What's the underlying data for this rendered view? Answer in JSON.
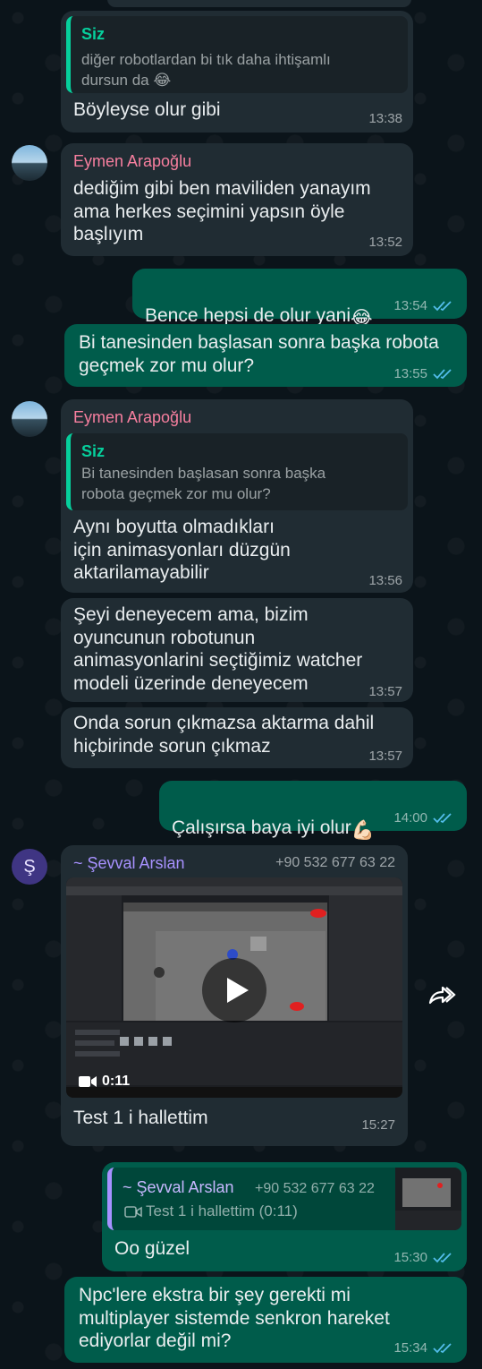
{
  "messages": {
    "m1": {
      "quote_name": "Siz",
      "quote_text": "diğer robotlardan bi tık daha ihtişamlı\ndursun da 😂",
      "text": "Böyleyse olur gibi",
      "time": "13:38"
    },
    "m2": {
      "sender": "Eymen Arapoğlu",
      "text": "dediğim gibi ben maviliden yanayım\nama herkes seçimini yapsın öyle\nbaşlıyım",
      "time": "13:52"
    },
    "m3": {
      "text": "Bence hepsi de olur yani",
      "emoji": "😂",
      "time": "13:54"
    },
    "m4": {
      "text": "Bi tanesinden başlasan sonra başka robota\ngeçmek zor mu olur?",
      "time": "13:55"
    },
    "m5": {
      "sender": "Eymen Arapoğlu",
      "quote_name": "Siz",
      "quote_text": "Bi tanesinden başlasan sonra başka\nrobota geçmek zor mu olur?",
      "text": "Aynı boyutta olmadıkları\niçin animasyonları düzgün\naktarilamayabilir",
      "time": "13:56"
    },
    "m6": {
      "text": "Şeyi deneyecem ama, bizim\noyuncunun robotunun\nanimasyonlarini seçtiğimiz watcher\nmodeli üzerinde deneyecem",
      "time": "13:57"
    },
    "m7": {
      "text": "Onda sorun çıkmazsa aktarma dahil\nhiçbirinde sorun çıkmaz",
      "time": "13:57"
    },
    "m8": {
      "text": "Çalışırsa baya iyi olur",
      "emoji": "💪🏻",
      "time": "14:00"
    },
    "m9": {
      "avatar_letter": "Ş",
      "sender": "~ Şevval Arslan",
      "phone": "+90 532 677 63 22",
      "video_duration": "0:11",
      "text": "Test 1 i hallettim",
      "time": "15:27"
    },
    "m10": {
      "quote_name": "~ Şevval Arslan",
      "quote_phone": "+90 532 677 63 22",
      "quote_text": "Test 1 i hallettim (0:11)",
      "text": "Oo güzel",
      "time": "15:30"
    },
    "m11": {
      "text": "Npc'lere ekstra bir şey gerekti mi\nmultiplayer sistemde senkron hareket\nediyorlar değil mi?",
      "time": "15:34"
    }
  },
  "icons": {
    "read_receipt": "double-check-icon",
    "forward": "forward-icon",
    "play": "play-icon",
    "video_camera": "video-camera-icon"
  },
  "colors": {
    "background": "#0b141a",
    "incoming_bubble": "#202c33",
    "outgoing_bubble": "#005c4b",
    "read_tick": "#53bdeb",
    "quote_accent": "#06cf9c",
    "sender_eymen": "#f77f9f",
    "sender_sevval": "#a791ff"
  }
}
